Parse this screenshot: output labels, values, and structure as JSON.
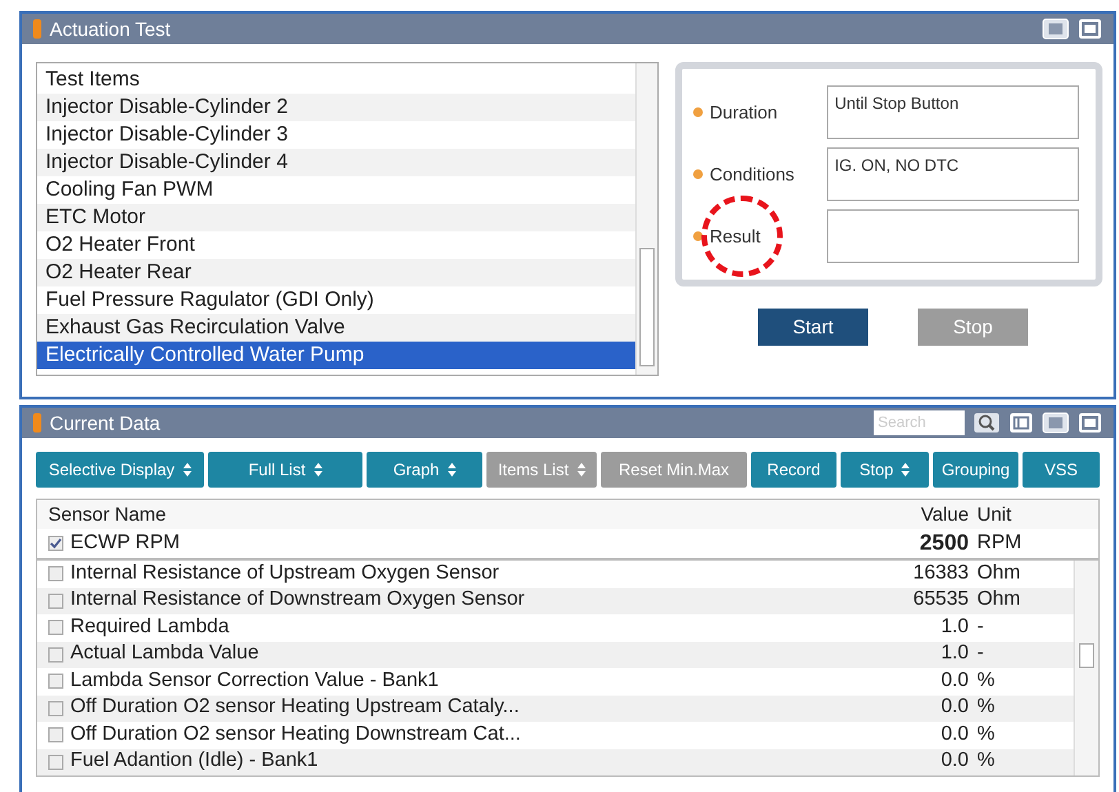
{
  "actuation_panel": {
    "title": "Actuation Test",
    "test_list": {
      "header": "Test Items",
      "items": [
        {
          "label": "Injector Disable-Cylinder 2",
          "selected": false
        },
        {
          "label": "Injector Disable-Cylinder 3",
          "selected": false
        },
        {
          "label": "Injector Disable-Cylinder 4",
          "selected": false
        },
        {
          "label": "Cooling Fan PWM",
          "selected": false
        },
        {
          "label": "ETC Motor",
          "selected": false
        },
        {
          "label": "O2 Heater Front",
          "selected": false
        },
        {
          "label": "O2 Heater Rear",
          "selected": false
        },
        {
          "label": "Fuel Pressure Ragulator (GDI Only)",
          "selected": false
        },
        {
          "label": "Exhaust Gas Recirculation Valve",
          "selected": false
        },
        {
          "label": "Electrically Controlled Water Pump",
          "selected": true
        }
      ]
    },
    "fields": [
      {
        "label": "Duration",
        "value": "Until Stop Button",
        "highlighted": false
      },
      {
        "label": "Conditions",
        "value": "IG. ON, NO DTC",
        "highlighted": false
      },
      {
        "label": "Result",
        "highlighted": true
      }
    ],
    "buttons": [
      {
        "label": "Start",
        "disabled": false
      },
      {
        "label": "Stop",
        "disabled": true
      }
    ]
  },
  "current_data_panel": {
    "title": "Current Data",
    "search": {
      "placeholder": "Search"
    },
    "toolbar": [
      {
        "label": "Selective Display",
        "dropdown": true,
        "disabled": false
      },
      {
        "label": "Full List",
        "dropdown": true,
        "disabled": false
      },
      {
        "label": "Graph",
        "dropdown": true,
        "disabled": false
      },
      {
        "label": "Items List",
        "dropdown": true,
        "disabled": true
      },
      {
        "label": "Reset Min.Max",
        "dropdown": false,
        "disabled": true
      },
      {
        "label": "Record",
        "dropdown": false,
        "disabled": false
      },
      {
        "label": "Stop",
        "dropdown": true,
        "disabled": false
      },
      {
        "label": "Grouping",
        "dropdown": false,
        "disabled": false
      },
      {
        "label": "VSS",
        "dropdown": false,
        "disabled": false
      }
    ],
    "table": {
      "columns": [
        "Sensor Name",
        "Value",
        "Unit"
      ],
      "pinned_rows": [
        {
          "name": "ECWP RPM",
          "value": "2500",
          "unit": "RPM",
          "checked": true
        }
      ],
      "rows": [
        {
          "name": "Internal Resistance of Upstream Oxygen Sensor",
          "value": "16383",
          "unit": "Ohm",
          "checked": false
        },
        {
          "name": "Internal Resistance of Downstream Oxygen Sensor",
          "value": "65535",
          "unit": "Ohm",
          "checked": false
        },
        {
          "name": "Required Lambda",
          "value": "1.0",
          "unit": "-",
          "checked": false
        },
        {
          "name": "Actual Lambda Value",
          "value": "1.0",
          "unit": "-",
          "checked": false
        },
        {
          "name": "Lambda Sensor Correction Value - Bank1",
          "value": "0.0",
          "unit": "%",
          "checked": false
        },
        {
          "name": "Off Duration O2 sensor Heating Upstream Cataly...",
          "value": "0.0",
          "unit": "%",
          "checked": false
        },
        {
          "name": "Off Duration O2 sensor Heating Downstream Cat...",
          "value": "0.0",
          "unit": "%",
          "checked": false
        },
        {
          "name": "Fuel Adantion (Idle) - Bank1",
          "value": "0.0",
          "unit": "%",
          "checked": false
        }
      ]
    }
  }
}
